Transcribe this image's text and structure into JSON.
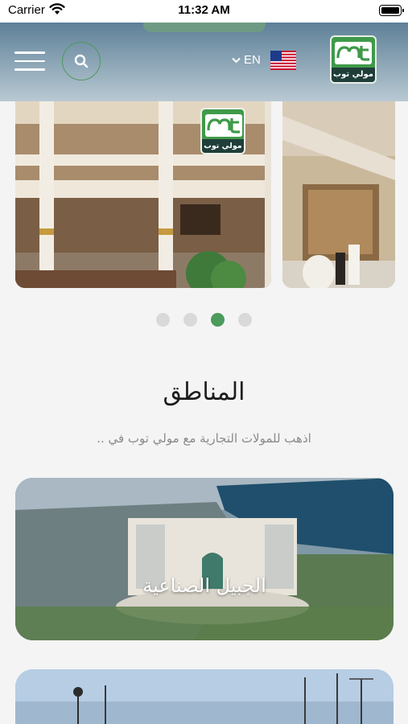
{
  "status_bar": {
    "carrier": "Carrier",
    "time": "11:32 AM"
  },
  "header": {
    "language": "EN",
    "logo_text": "مولي توب",
    "colors": {
      "brand_green": "#3f9a49",
      "logo_dark": "#1f3e3a",
      "active_dot": "#4c9a5c"
    }
  },
  "carousel": {
    "slides": [
      {
        "logo_text": "مولي توب"
      },
      {}
    ],
    "page_count": 4,
    "active_index": 2
  },
  "regions": {
    "title": "المناطق",
    "subtitle": "اذهب للمولات التجارية مع مولي توب في ..",
    "items": [
      {
        "name": "الجبيل الصناعية"
      },
      {
        "name": ""
      }
    ]
  }
}
